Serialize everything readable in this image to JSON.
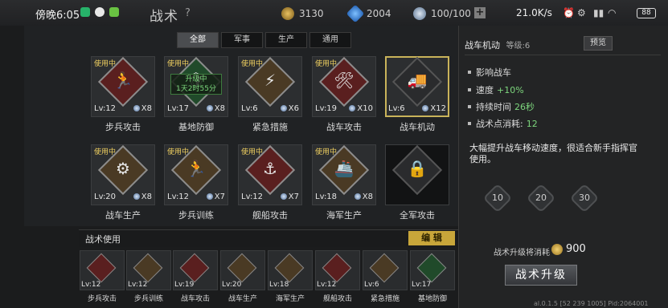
{
  "status": {
    "time": "傍晚6:05",
    "net_speed": "21.0K/s",
    "battery": "88"
  },
  "header": {
    "title": "战术",
    "help": "?",
    "gold": "3130",
    "diamond": "2004",
    "capacity": "100/100"
  },
  "tabs": [
    {
      "label": "全部"
    },
    {
      "label": "军事"
    },
    {
      "label": "生产"
    },
    {
      "label": "通用"
    }
  ],
  "cards": [
    {
      "in_use": "使用中",
      "level": "Lv:12",
      "count": "X8",
      "name": "步兵攻击",
      "glyph": "🏃"
    },
    {
      "in_use": "使用中",
      "level": "Lv:17",
      "count": "X8",
      "name": "基地防御",
      "glyph": "🛡",
      "upgrade_line1": "升级中",
      "upgrade_line2": "1天2时55分"
    },
    {
      "in_use": "使用中",
      "level": "Lv:6",
      "count": "X6",
      "name": "紧急措施",
      "glyph": "⚡"
    },
    {
      "in_use": "使用中",
      "level": "Lv:19",
      "count": "X10",
      "name": "战车攻击",
      "glyph": "🛠"
    },
    {
      "in_use": "",
      "level": "Lv:6",
      "count": "X12",
      "name": "战车机动",
      "glyph": "🚚"
    },
    {
      "in_use": "使用中",
      "level": "Lv:20",
      "count": "X8",
      "name": "战车生产",
      "glyph": "⚙"
    },
    {
      "in_use": "使用中",
      "level": "Lv:12",
      "count": "X7",
      "name": "步兵训练",
      "glyph": "🏃"
    },
    {
      "in_use": "使用中",
      "level": "Lv:12",
      "count": "X7",
      "name": "舰船攻击",
      "glyph": "⚓"
    },
    {
      "in_use": "使用中",
      "level": "Lv:18",
      "count": "X8",
      "name": "海军生产",
      "glyph": "🚢"
    },
    {
      "in_use": "",
      "level": "",
      "count": "",
      "name": "全军攻击",
      "glyph": "🔒"
    }
  ],
  "tactics_section": {
    "title": "战术使用",
    "edit_label": "编 辑",
    "items": [
      {
        "level": "Lv:12",
        "name": "步兵攻击"
      },
      {
        "level": "Lv:12",
        "name": "步兵训练"
      },
      {
        "level": "Lv:19",
        "name": "战车攻击"
      },
      {
        "level": "Lv:20",
        "name": "战车生产"
      },
      {
        "level": "Lv:18",
        "name": "海军生产"
      },
      {
        "level": "Lv:12",
        "name": "舰船攻击"
      },
      {
        "level": "Lv:6",
        "name": "紧急措施"
      },
      {
        "level": "Lv:17",
        "name": "基地防御"
      }
    ]
  },
  "detail": {
    "title": "战车机动",
    "level": "等级:6",
    "preview": "预览",
    "attrs": [
      {
        "label": "影响战车",
        "value": ""
      },
      {
        "label": "速度",
        "value": "+10%"
      },
      {
        "label": "持续时间",
        "value": "26秒"
      },
      {
        "label": "战术点消耗:",
        "value": "12"
      }
    ],
    "description": "大幅提升战车移动速度，很适合新手指挥官使用。",
    "level_buttons": [
      "10",
      "20",
      "30"
    ],
    "cost_label": "战术升级将消耗",
    "cost_value": "900",
    "upgrade_label": "战术升级",
    "version": "al.0.1.5 [52 239 1005] Pid:2064001"
  },
  "colors": {
    "gold_accent": "#c8a63a",
    "positive_green": "#7dd67d",
    "in_use_yellow": "#f0d060"
  }
}
